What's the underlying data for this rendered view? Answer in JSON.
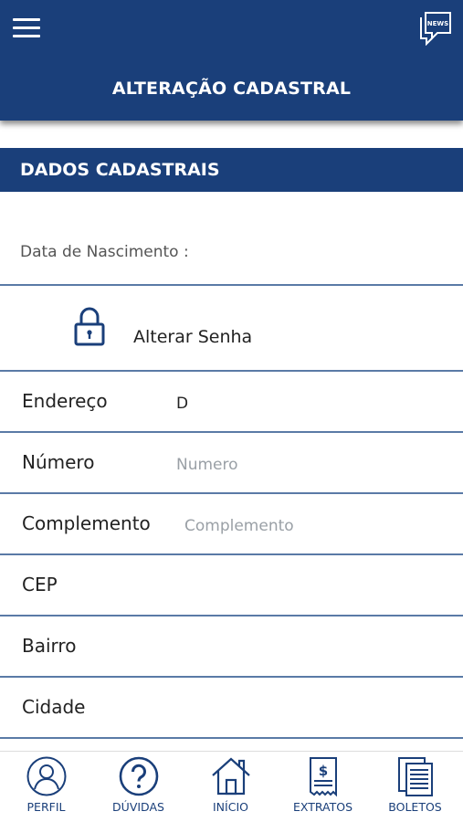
{
  "header": {
    "title": "ALTERAÇÃO CADASTRAL",
    "menu_icon": "hamburger-menu-icon",
    "news_icon": "news-chat-icon",
    "news_badge": "NEWS",
    "color": "#1a3f7a"
  },
  "section": {
    "title": "DADOS CADASTRAIS"
  },
  "birth": {
    "label": "Data de Nascimento :"
  },
  "password": {
    "label": "Alterar Senha",
    "icon": "lock-icon"
  },
  "fields": {
    "endereco": {
      "label": "Endereço",
      "value": "D",
      "placeholder": ""
    },
    "numero": {
      "label": "Número",
      "value": "",
      "placeholder": "Numero"
    },
    "complemento": {
      "label": "Complemento",
      "value": "",
      "placeholder": "Complemento"
    },
    "cep": {
      "label": "CEP",
      "value": "",
      "placeholder": ""
    },
    "bairro": {
      "label": "Bairro",
      "value": "",
      "placeholder": ""
    },
    "cidade": {
      "label": "Cidade",
      "value": "",
      "placeholder": ""
    }
  },
  "tabs": [
    {
      "label": "PERFIL",
      "icon": "user-profile-icon"
    },
    {
      "label": "DÚVIDAS",
      "icon": "question-circle-icon"
    },
    {
      "label": "INÍCIO",
      "icon": "home-icon"
    },
    {
      "label": "EXTRATOS",
      "icon": "receipt-dollar-icon"
    },
    {
      "label": "BOLETOS",
      "icon": "documents-icon"
    }
  ]
}
